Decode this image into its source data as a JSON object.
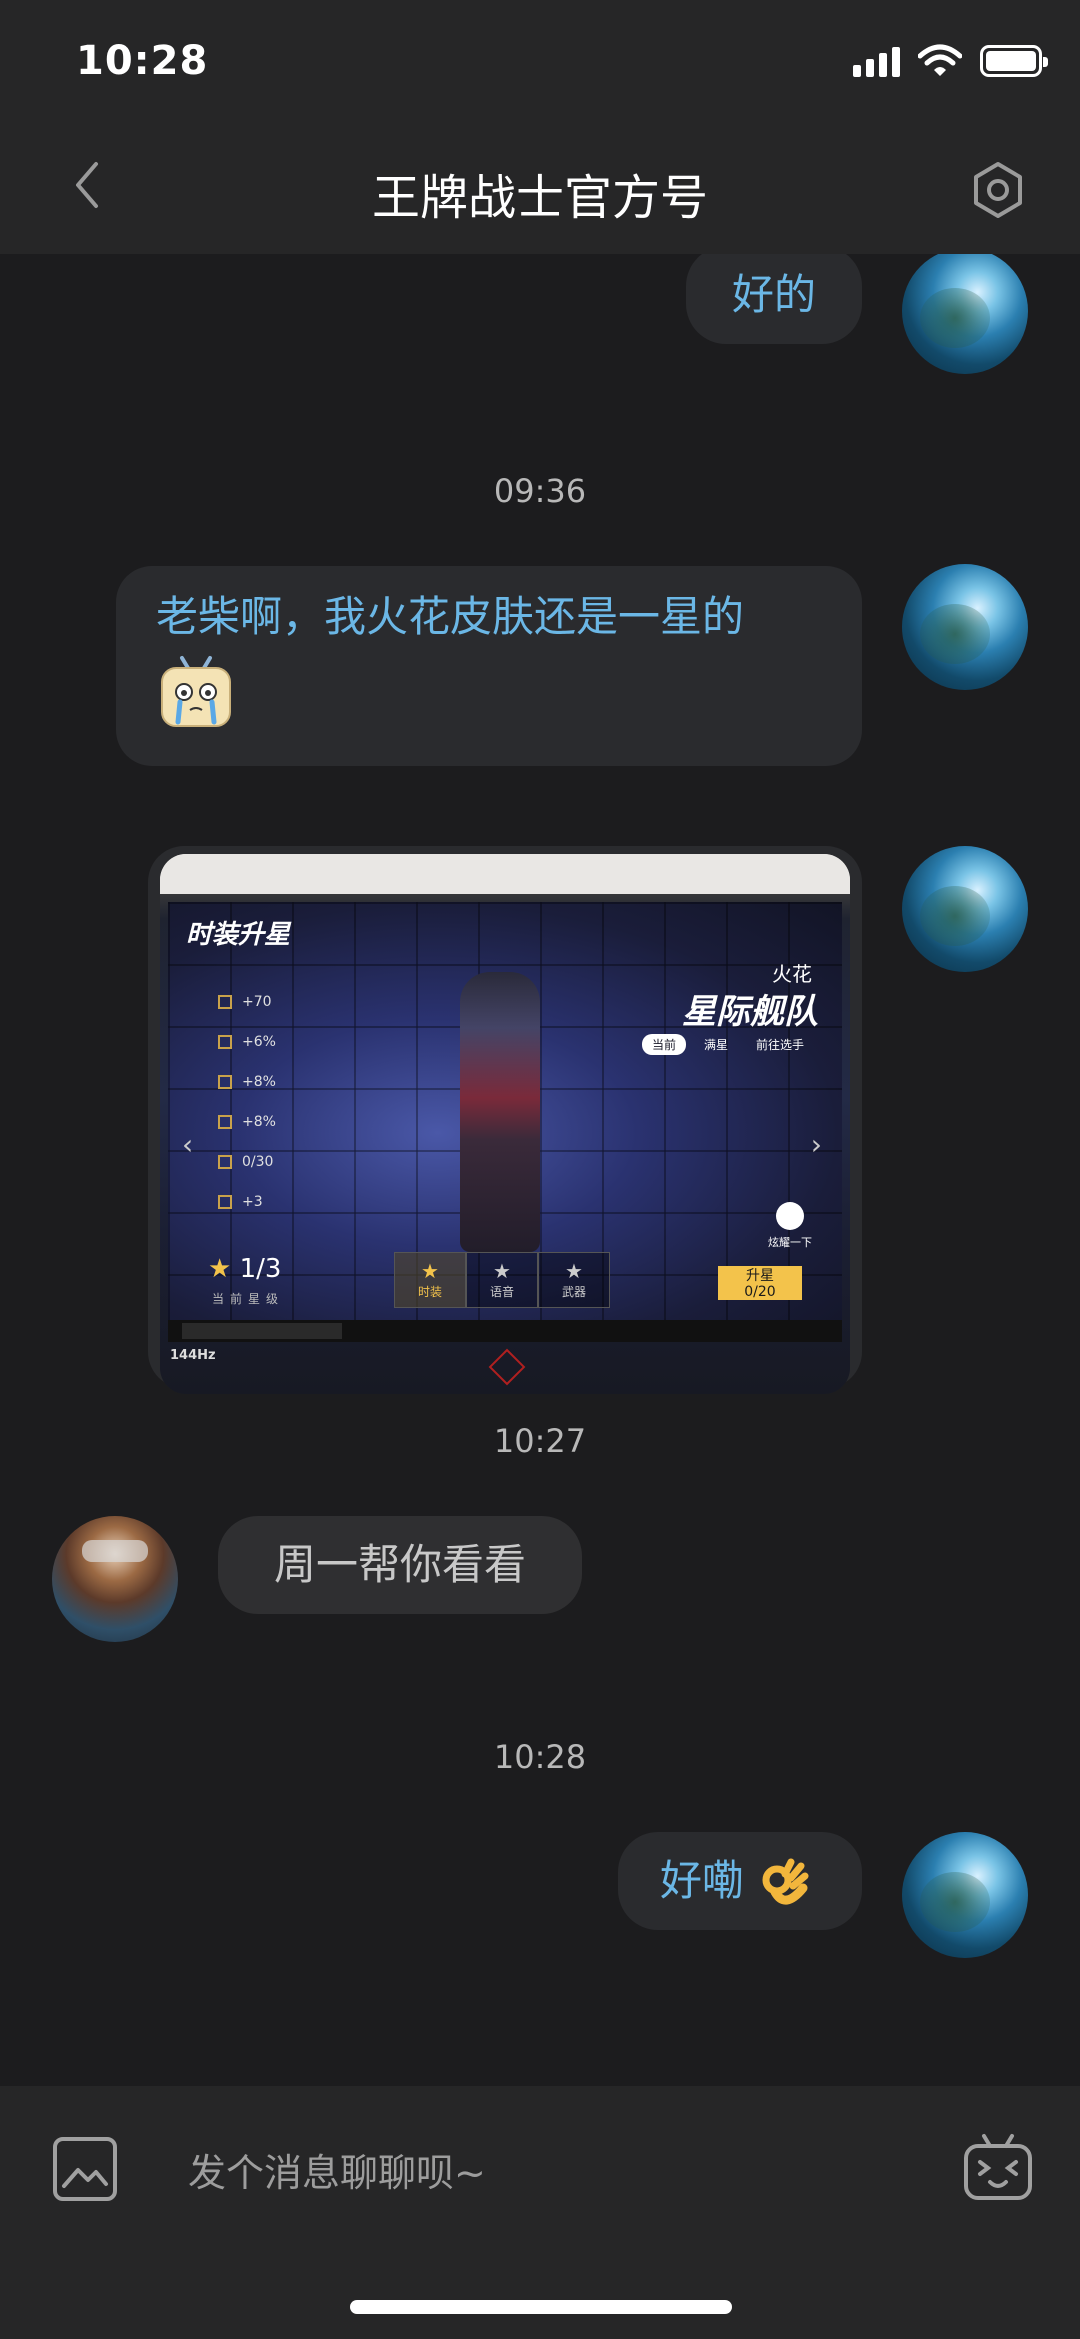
{
  "status_bar": {
    "time": "10:28"
  },
  "nav": {
    "title": "王牌战士官方号"
  },
  "messages": {
    "m1": {
      "text": "好的"
    },
    "ts1": "09:36",
    "m2": {
      "text": "老柴啊，我火花皮肤还是一星的"
    },
    "m3_image": {
      "game_title": "时装升星",
      "character": "火花",
      "skin": "星际舰队",
      "pill_current": "当前",
      "pill_full": "满星",
      "pill_goto": "前往选手",
      "stats": [
        "+70",
        "+6%",
        "+8%",
        "+8%",
        "0/30",
        "+3"
      ],
      "star_rating": "1/3",
      "star_caption": "当前星级",
      "tabs": [
        "时装",
        "语音",
        "武器"
      ],
      "upgrade_label": "升星",
      "upgrade_progress": "0/20",
      "share_label": "炫耀一下",
      "refresh_label": "144Hz"
    },
    "ts2": "10:27",
    "m4": {
      "text": "周一帮你看看"
    },
    "ts3": "10:28",
    "m5": {
      "text": "好嘞"
    }
  },
  "input": {
    "placeholder": "发个消息聊聊呗~"
  },
  "colors": {
    "mine_text": "#6bb7e6",
    "theirs_text": "#c8c8c8",
    "background": "#1c1c1e",
    "bar": "#262627"
  }
}
